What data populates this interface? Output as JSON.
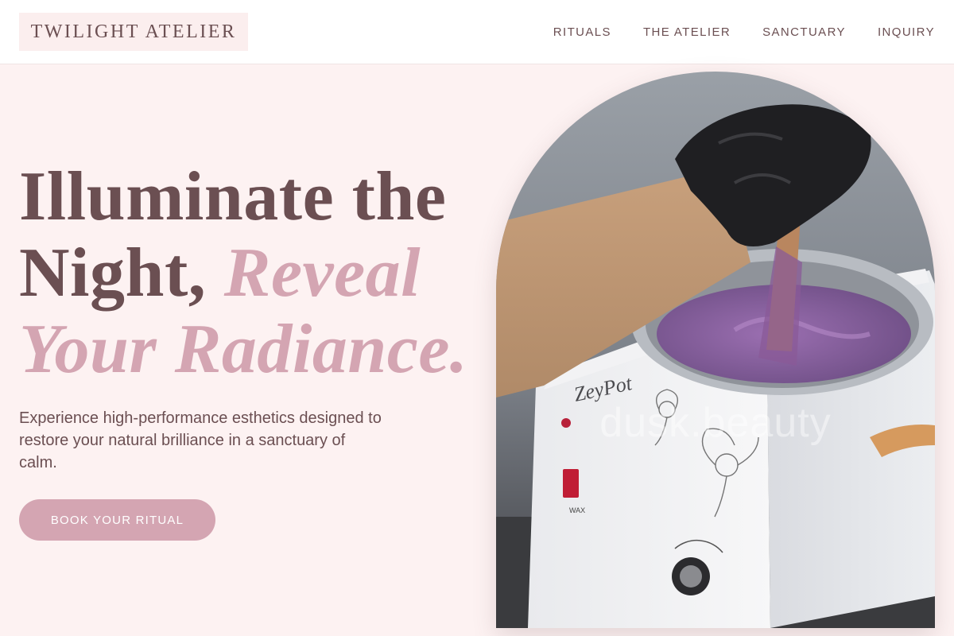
{
  "header": {
    "logo": "TWILIGHT ATELIER",
    "nav": [
      {
        "label": "RITUALS"
      },
      {
        "label": "THE ATELIER"
      },
      {
        "label": "SANCTUARY"
      },
      {
        "label": "INQUIRY"
      }
    ]
  },
  "hero": {
    "headline_part1": "Illuminate the",
    "headline_part2": "Night,",
    "headline_accent_part1": "Reveal",
    "headline_accent_part2": "Your Radiance.",
    "lede": "Experience high-performance esthetics designed to restore your natural brilliance in a sanctuary of calm.",
    "cta_label": "BOOK YOUR RITUAL",
    "image_watermark": "dusk.beauty"
  },
  "colors": {
    "background": "#fdf2f2",
    "text": "#6b4f52",
    "accent": "#d4a5b2",
    "header_bg": "#ffffff"
  }
}
